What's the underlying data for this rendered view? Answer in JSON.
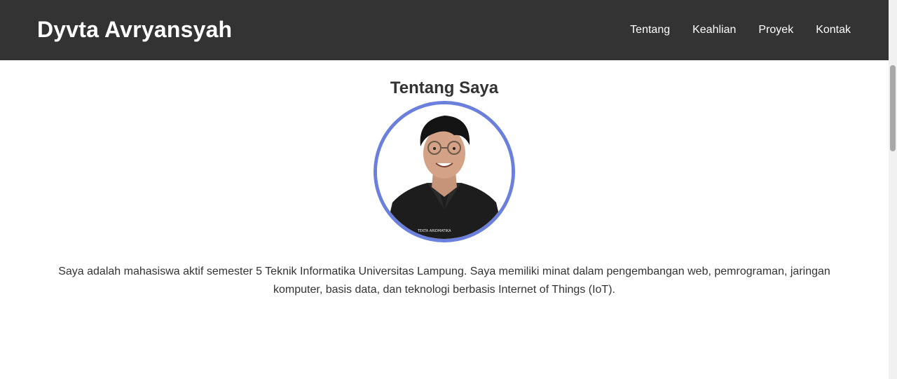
{
  "header": {
    "brand": "Dyvta Avryansyah",
    "nav": [
      {
        "label": "Tentang"
      },
      {
        "label": "Keahlian"
      },
      {
        "label": "Proyek"
      },
      {
        "label": "Kontak"
      }
    ]
  },
  "about": {
    "title": "Tentang Saya",
    "photo_alt": "Profile photo",
    "shirt_text": "TEKTA ARIDMATIKA",
    "description": "Saya adalah mahasiswa aktif semester 5 Teknik Informatika Universitas Lampung. Saya memiliki minat dalam pengembangan web, pemrograman, jaringan komputer, basis data, dan teknologi berbasis Internet of Things (IoT)."
  },
  "colors": {
    "navbar_bg": "#333333",
    "brand_text": "#ffffff",
    "accent_ring": "#6b7fdc",
    "body_text": "#333333"
  }
}
